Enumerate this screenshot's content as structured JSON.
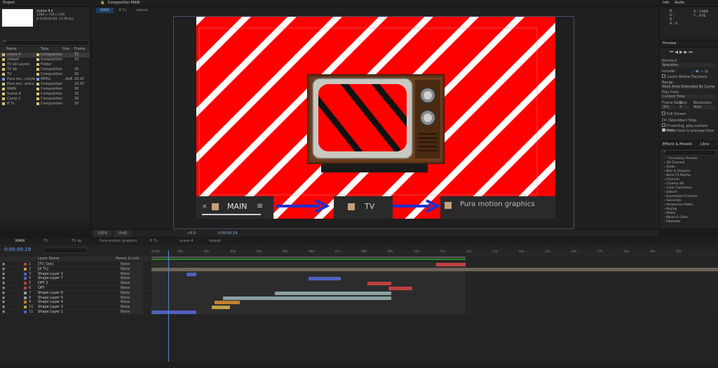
{
  "project": {
    "title": "Project",
    "comp_name": "scene 4 ▾",
    "comp_info_1": "1280 x 720 (1.00)",
    "comp_info_2": "Δ 0;00;08;00, 23.98 fps",
    "search_placeholder": "",
    "columns": [
      "Name",
      "Type",
      "Size",
      "Frame R..."
    ],
    "items": [
      {
        "name": "scene 4",
        "type": "Composition",
        "size": "",
        "fr": "23",
        "color": "#d9c27a"
      },
      {
        "name": "video4",
        "type": "Composition",
        "size": "",
        "fr": "23",
        "color": "#d9c27a"
      },
      {
        "name": "TV ab Layers",
        "type": "Folder",
        "size": "",
        "fr": "",
        "color": "#d9c27a"
      },
      {
        "name": "TV ab",
        "type": "Composition",
        "size": "",
        "fr": "30",
        "color": "#d9c27a"
      },
      {
        "name": "TV",
        "type": "Composition",
        "size": "",
        "fr": "30",
        "color": "#d9c27a"
      },
      {
        "name": "Pura mo...cstyle",
        "type": "MPEG",
        "size": "...6kB",
        "fr": "29.97",
        "color": "#7a9ad9"
      },
      {
        "name": "Pura mo...phics",
        "type": "Composition",
        "size": "",
        "fr": "29.97",
        "color": "#d9c27a"
      },
      {
        "name": "MAIN",
        "type": "Composition",
        "size": "",
        "fr": "30",
        "color": "#d9c27a"
      },
      {
        "name": "Scene 6",
        "type": "Composition",
        "size": "",
        "fr": "30",
        "color": "#d9c27a"
      },
      {
        "name": "Comp 1",
        "type": "Composition",
        "size": "",
        "fr": "30",
        "color": "#d9c27a"
      },
      {
        "name": "8 Tv",
        "type": "Composition",
        "size": "",
        "fr": "30",
        "color": "#d9c27a"
      }
    ]
  },
  "composition": {
    "title": "Composition MAIN",
    "tabs": [
      "MAIN",
      "8 Tv",
      "video4"
    ],
    "nav": [
      {
        "label": "MAIN"
      },
      {
        "label": "TV"
      },
      {
        "label": "Pura motion graphics"
      }
    ],
    "zoom": "100%",
    "resolution": "(Full)",
    "timecode": "0;00;00;19",
    "exposure": "+0.0"
  },
  "info": {
    "tabs": [
      "Info",
      "Audio"
    ],
    "r": "R :",
    "g": "G :",
    "b": "B :",
    "a": "A : 0",
    "x": "X : 1488",
    "y": "Y : 476"
  },
  "preview": {
    "title": "Preview",
    "shortcut_label": "Shortcut",
    "shortcut_value": "Spacebar",
    "include_label": "Include:",
    "cache_label": "Cache Before Playback",
    "range_label": "Range",
    "range_value": "Work Area Extended By Current...",
    "play_from_label": "Play From",
    "play_from_value": "Current Time",
    "frame_rate_label": "Frame Rate",
    "skip_label": "Skip",
    "resolution_label": "Resolution",
    "frame_rate_value": "(30)",
    "skip_value": "0",
    "resolution_value": "Auto",
    "fullscreen_label": "Full Screen",
    "on_stop_label": "On (Spacebar) Stop:",
    "if_caching_label": "If caching, play cached frames",
    "move_time_label": "Move time to preview time"
  },
  "effects": {
    "tabs": [
      "Effects & Presets",
      "Libra"
    ],
    "search_placeholder": "",
    "items": [
      "* Animation Presets",
      "3D Channel",
      "Audio",
      "Blur & Sharpen",
      "Boris FX Mocha",
      "Channel",
      "Cinema 4D",
      "Color Correction",
      "Distort",
      "Expression Controls",
      "Generate",
      "Immersive Video",
      "Keying",
      "Matte",
      "Noise & Grain",
      "Obsolete"
    ]
  },
  "timeline": {
    "tabs": [
      "MAIN",
      "TV",
      "TV ab",
      "Pura motion graphics",
      "8 Tv",
      "scene 4",
      "video4"
    ],
    "timecode": "0:00:00:19",
    "columns": {
      "name": "Layer Name",
      "parent": "Parent & Link"
    },
    "ruler": [
      "0:00s",
      "01s",
      "02s",
      "03s",
      "04s",
      "05s",
      "06s",
      "07s",
      "08s",
      "09s",
      "10s",
      "11s",
      "12s",
      "13s",
      "14s",
      "15s",
      "16s",
      "17s",
      "18s",
      "19s",
      "20s"
    ],
    "layers": [
      {
        "num": "1",
        "name": "[TV_Out]",
        "parent": "None",
        "color": "#c04040"
      },
      {
        "num": "2",
        "name": "[8 Tv]",
        "parent": "None",
        "color": "#c0a040"
      },
      {
        "num": "3",
        "name": "Shape Layer 2",
        "parent": "None",
        "color": "#5060c0"
      },
      {
        "num": "4",
        "name": "Shape Layer 7",
        "parent": "None",
        "color": "#5060c0"
      },
      {
        "num": "5",
        "name": "OFF 2",
        "parent": "None",
        "color": "#c04040"
      },
      {
        "num": "6",
        "name": "OFF",
        "parent": "None",
        "color": "#c04040"
      },
      {
        "num": "7",
        "name": "Shape Layer 6",
        "parent": "None",
        "color": "#8aa0a0"
      },
      {
        "num": "8",
        "name": "Shape Layer 5",
        "parent": "None",
        "color": "#8aa0a0"
      },
      {
        "num": "9",
        "name": "Shape Layer 4",
        "parent": "None",
        "color": "#c08030"
      },
      {
        "num": "10",
        "name": "Shape Layer 3",
        "parent": "None",
        "color": "#c0a040"
      },
      {
        "num": "11",
        "name": "Shape Layer 1",
        "parent": "None",
        "color": "#5060c0"
      }
    ]
  }
}
